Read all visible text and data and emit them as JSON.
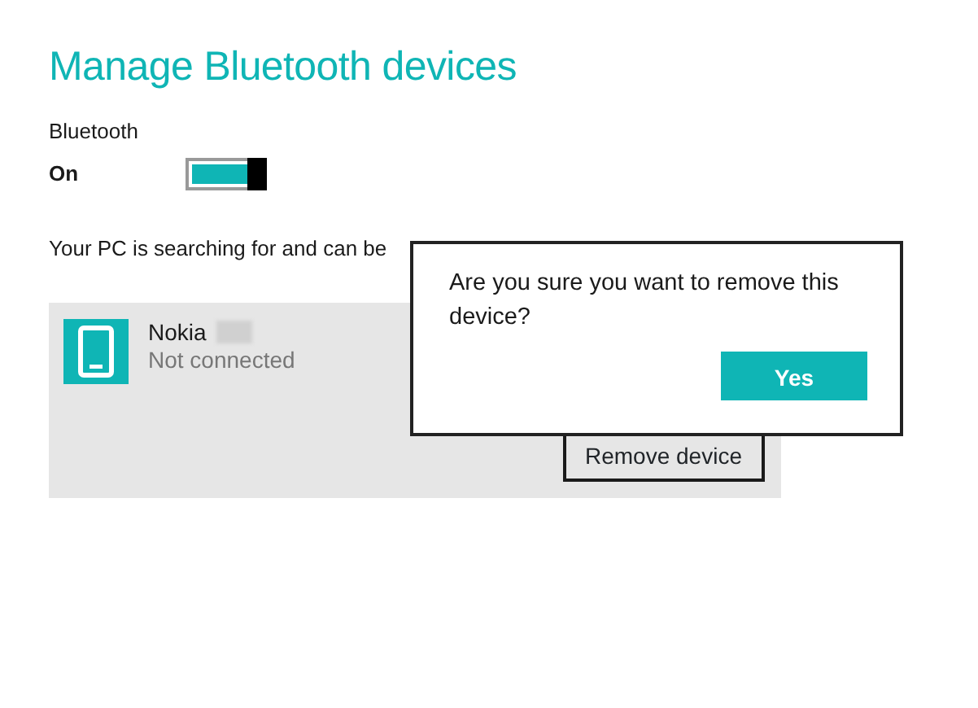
{
  "title": "Manage Bluetooth devices",
  "bluetooth": {
    "label": "Bluetooth",
    "state_text": "On",
    "on": true
  },
  "status_text": "Your PC is searching for and can be",
  "devices": [
    {
      "name": "Nokia",
      "status": "Not connected",
      "selected": true,
      "action": "Remove device"
    }
  ],
  "dialog": {
    "message": "Are you sure you want to remove this device?",
    "button": "Yes"
  }
}
